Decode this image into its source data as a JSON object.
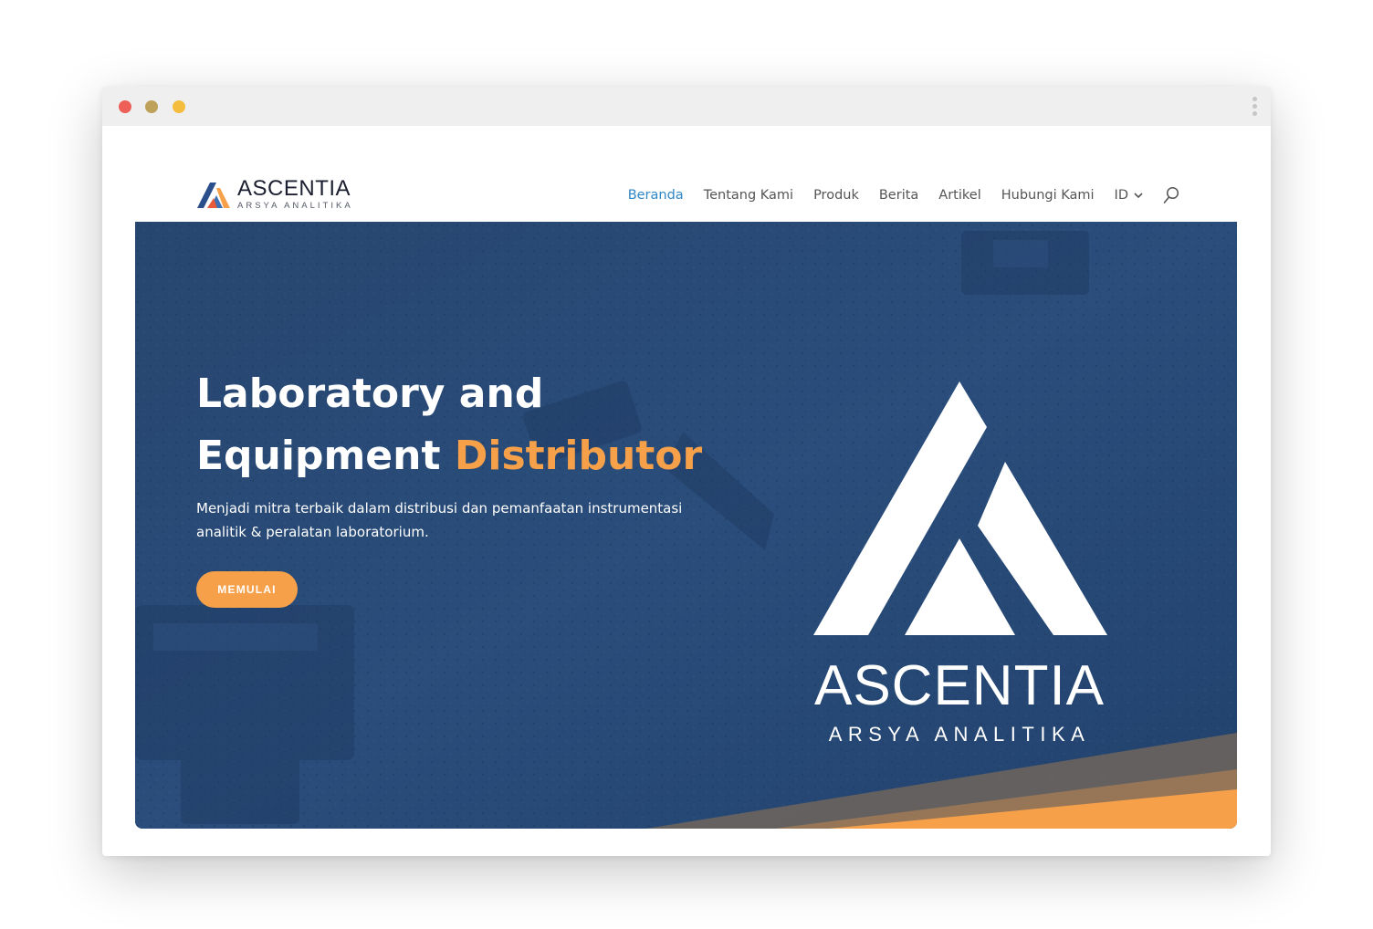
{
  "window": {
    "controls": {
      "close_color": "#ed5f57",
      "minimize_color": "#bfa25a",
      "maximize_color": "#f4bd3e"
    },
    "menu_icon": "kebab-menu-icon"
  },
  "header": {
    "logo": {
      "name": "ASCENTIA",
      "tagline": "ARSYA ANALITIKA",
      "icon": "ascentia-mountain-logo"
    },
    "nav": [
      {
        "label": "Beranda",
        "active": true
      },
      {
        "label": "Tentang Kami",
        "active": false
      },
      {
        "label": "Produk",
        "active": false
      },
      {
        "label": "Berita",
        "active": false
      },
      {
        "label": "Artikel",
        "active": false
      },
      {
        "label": "Hubungi Kami",
        "active": false
      }
    ],
    "language": "ID",
    "search_icon": "search-icon",
    "active_color": "#2e87c6"
  },
  "hero": {
    "title_line1": "Laboratory and",
    "title_line2_prefix": "Equipment",
    "title_accent": "Distributor",
    "description": "Menjadi mitra terbaik dalam distribusi dan pemanfaatan instrumentasi analitik & peralatan laboratorium.",
    "cta_label": "MEMULAI",
    "brand_name": "ASCENTIA",
    "brand_tagline": "ARSYA ANALITIKA",
    "background_color": "#264a78",
    "accent_color": "#f7a04a"
  }
}
